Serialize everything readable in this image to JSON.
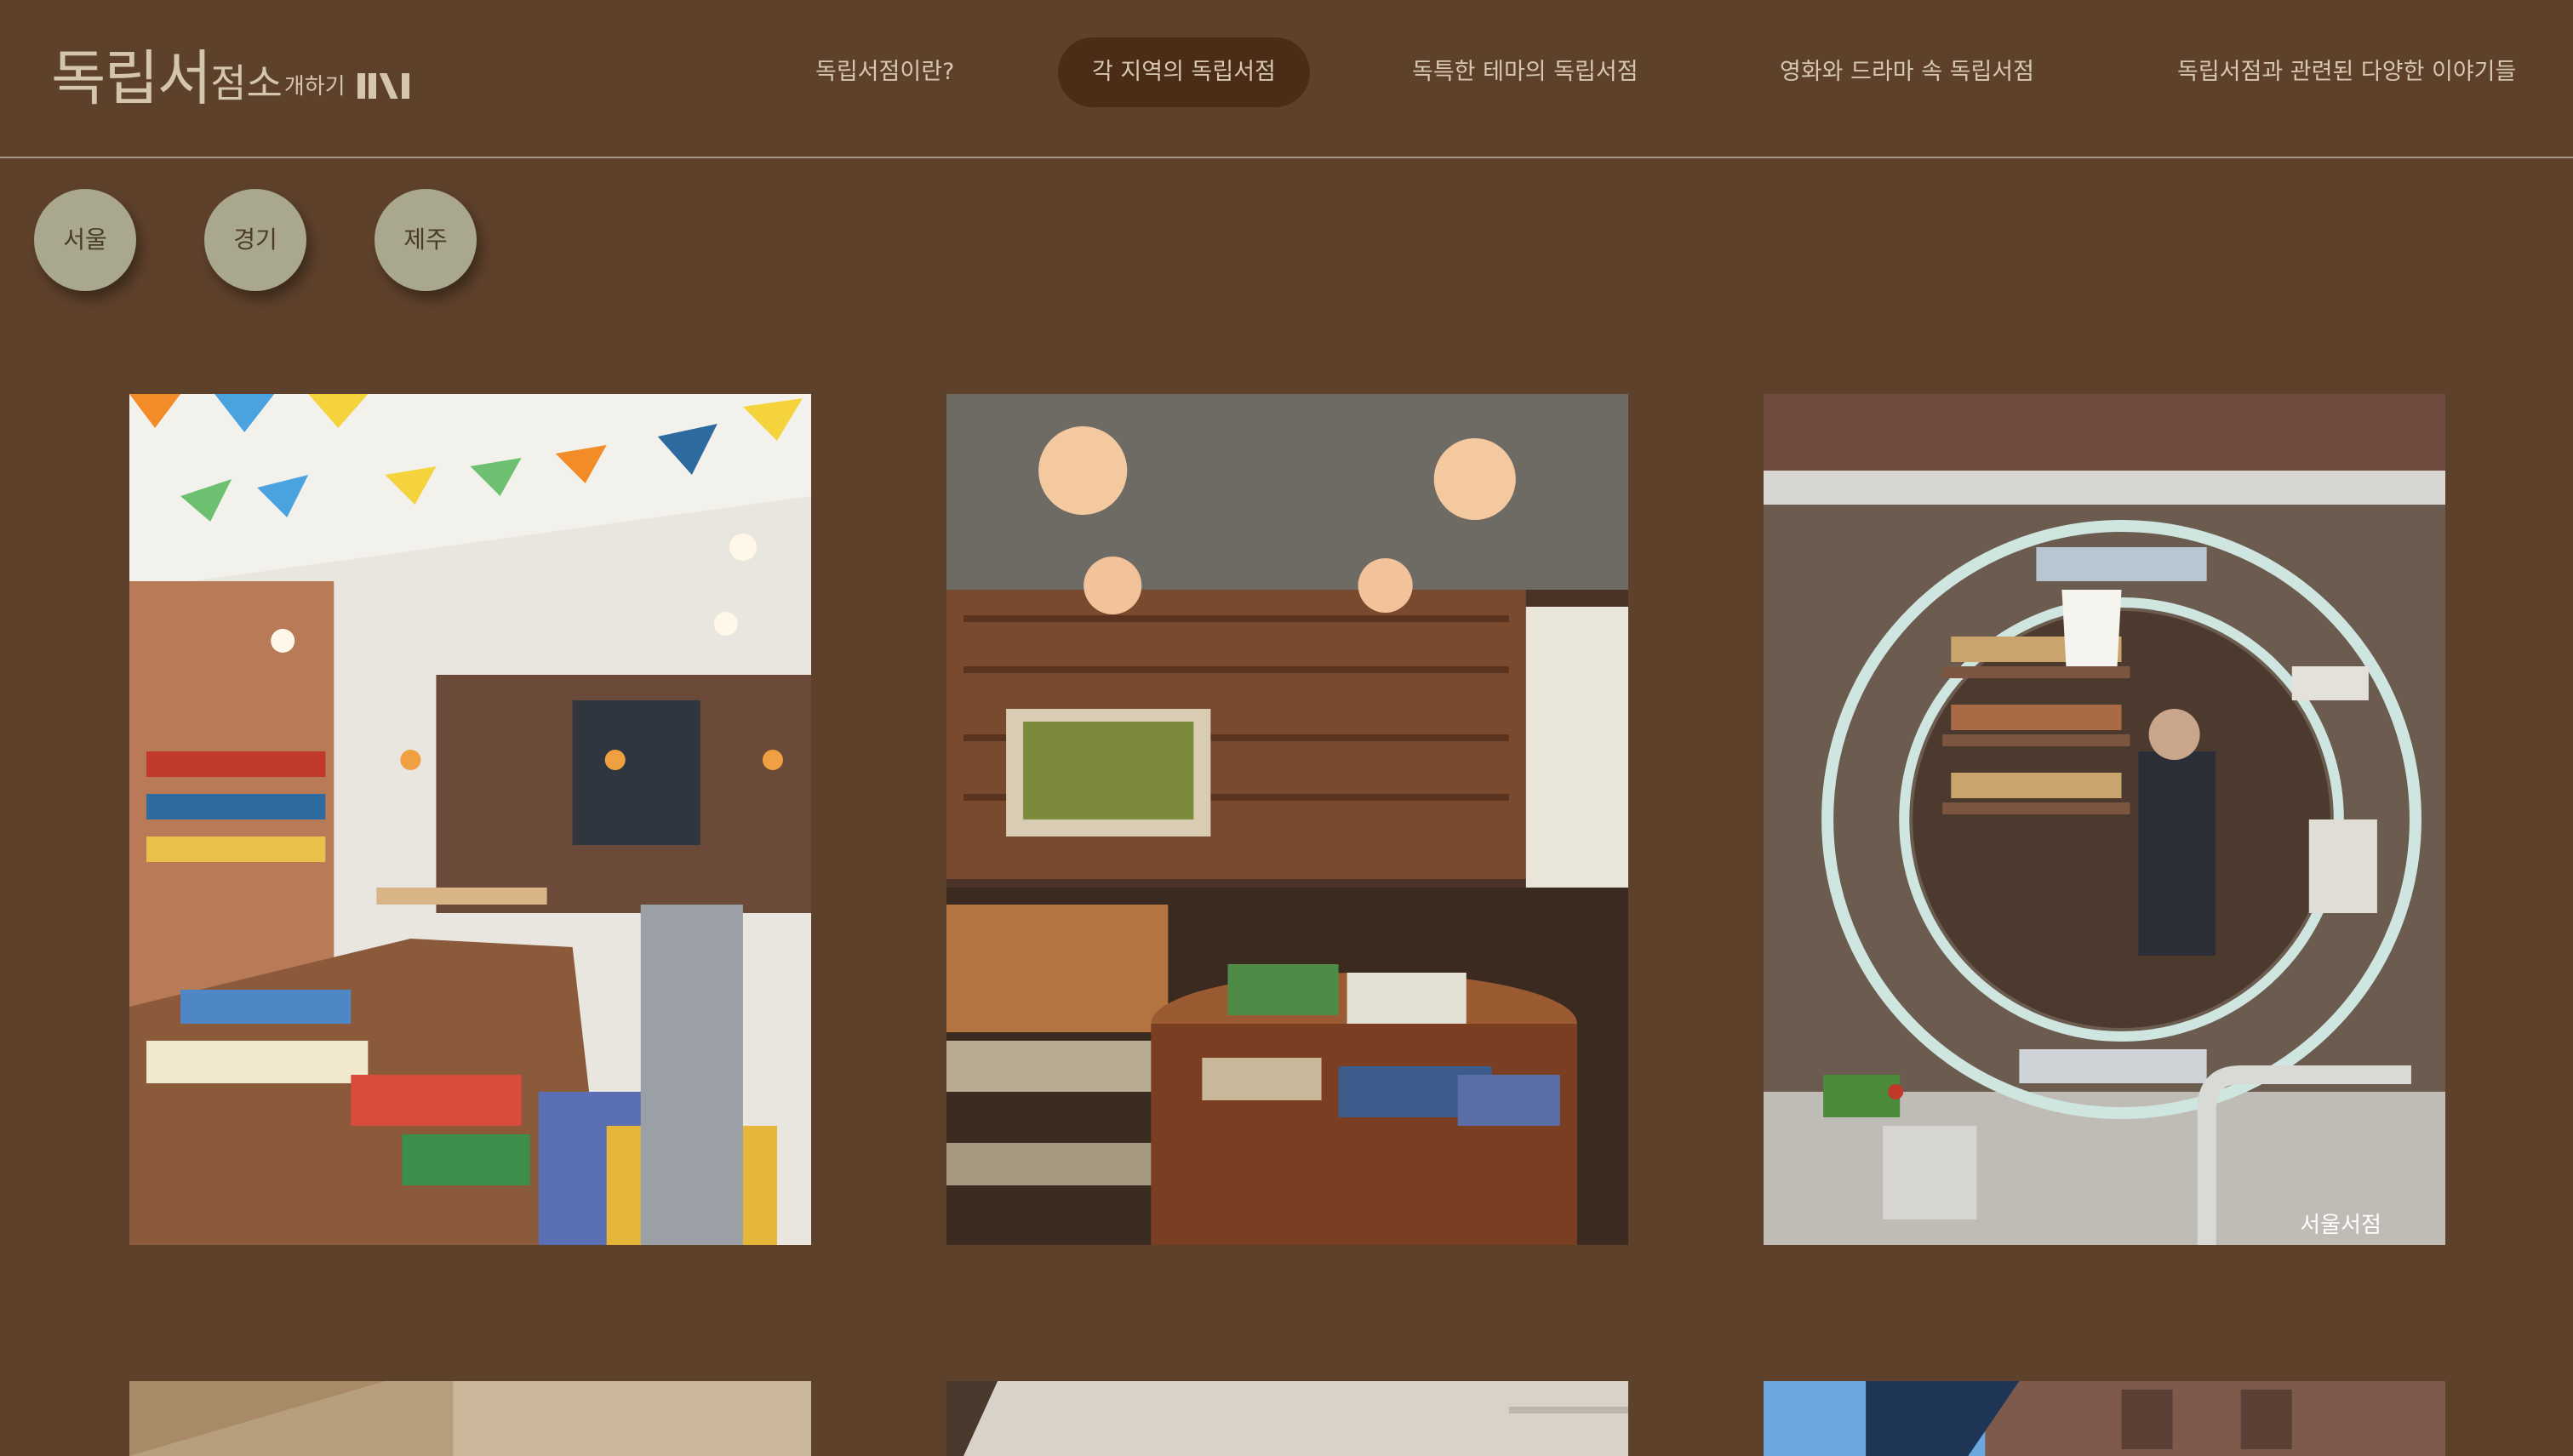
{
  "logo": {
    "part1": "독립서",
    "part2": "점소",
    "part3": "개하기"
  },
  "nav": [
    {
      "label": "독립서점이란?"
    },
    {
      "label": "각 지역의 독립서점",
      "active": true
    },
    {
      "label": "독특한 테마의 독립서점"
    },
    {
      "label": "영화와 드라마 속 독립서점"
    },
    {
      "label": "독립서점과 관련된 다양한 이야기들"
    }
  ],
  "regions": [
    {
      "label": "서울"
    },
    {
      "label": "경기"
    },
    {
      "label": "제주"
    }
  ],
  "colors": {
    "page_bg": "#5e412b",
    "active_nav_bg": "#4a2c17",
    "chip_bg": "#a9a78d",
    "nav_text": "#d6c8ae"
  },
  "gallery": {
    "photo_caption_3": "서울서점"
  }
}
